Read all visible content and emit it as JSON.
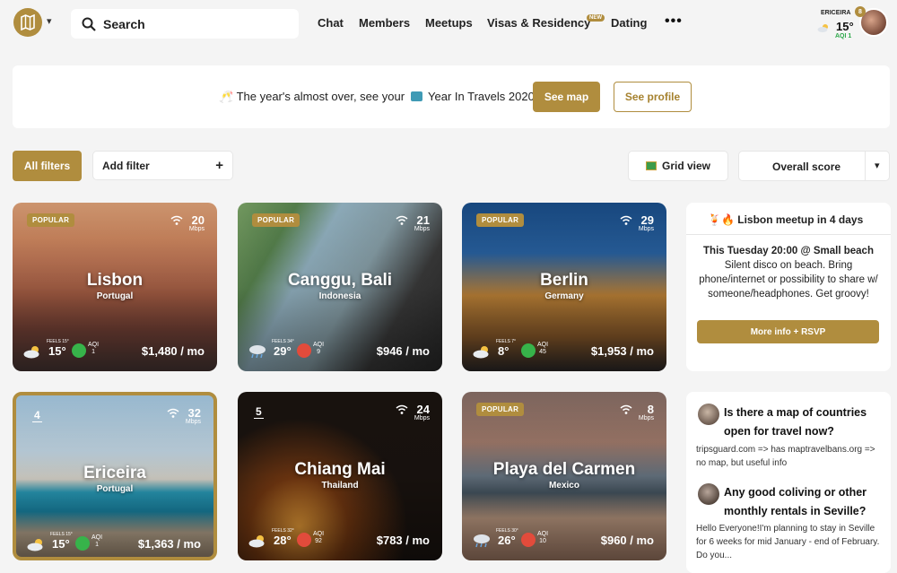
{
  "header": {
    "search_label": "Search",
    "nav": [
      {
        "label": "Chat"
      },
      {
        "label": "Members"
      },
      {
        "label": "Meetups"
      },
      {
        "label": "Visas & Residency"
      },
      {
        "label": "Dating"
      }
    ],
    "new_badge": "NEW",
    "more": "•••",
    "location": {
      "name": "ERICEIRA",
      "temp": "15°",
      "aqi": "AQI 1",
      "notifications": "8"
    }
  },
  "banner": {
    "text_part1": "The year's almost over, see your",
    "text_part2": "Year In Travels 2020",
    "see_map": "See map",
    "see_profile": "See profile"
  },
  "filters": {
    "all_filters": "All filters",
    "add_filter": "Add filter",
    "add_icon": "+",
    "grid_view": "Grid view",
    "sort": "Overall score"
  },
  "cities": [
    {
      "rank": "",
      "popular": "POPULAR",
      "mbps": "20",
      "mbps_unit": "Mbps",
      "name": "Lisbon",
      "country": "Portugal",
      "feels": "FEELS 15°",
      "temp": "15°",
      "aqi_label": "AQI",
      "aqi": "1",
      "price": "$1,480 / mo",
      "weather": "cloud-sun",
      "aqi_face": "happy"
    },
    {
      "rank": "",
      "popular": "POPULAR",
      "mbps": "21",
      "mbps_unit": "Mbps",
      "name": "Canggu, Bali",
      "country": "Indonesia",
      "feels": "FEELS 34°",
      "temp": "29°",
      "aqi_label": "AQI",
      "aqi": "9",
      "price": "$946 / mo",
      "weather": "rain",
      "aqi_face": "angry"
    },
    {
      "rank": "",
      "popular": "POPULAR",
      "mbps": "29",
      "mbps_unit": "Mbps",
      "name": "Berlin",
      "country": "Germany",
      "feels": "FEELS 7°",
      "temp": "8°",
      "aqi_label": "AQI",
      "aqi": "45",
      "price": "$1,953 / mo",
      "weather": "cloud-sun",
      "aqi_face": "happy"
    },
    {
      "rank": "4",
      "popular": "",
      "mbps": "32",
      "mbps_unit": "Mbps",
      "name": "Ericeira",
      "country": "Portugal",
      "feels": "FEELS 15°",
      "temp": "15°",
      "aqi_label": "AQI",
      "aqi": "1",
      "price": "$1,363 / mo",
      "weather": "cloud-sun",
      "aqi_face": "happy"
    },
    {
      "rank": "5",
      "popular": "",
      "mbps": "24",
      "mbps_unit": "Mbps",
      "name": "Chiang Mai",
      "country": "Thailand",
      "feels": "FEELS 32°",
      "temp": "28°",
      "aqi_label": "AQI",
      "aqi": "92",
      "price": "$783 / mo",
      "weather": "cloud-sun",
      "aqi_face": "angry"
    },
    {
      "rank": "",
      "popular": "POPULAR",
      "mbps": "8",
      "mbps_unit": "Mbps",
      "name": "Playa del Carmen",
      "country": "Mexico",
      "feels": "FEELS 30°",
      "temp": "26°",
      "aqi_label": "AQI",
      "aqi": "10",
      "price": "$960 / mo",
      "weather": "rain",
      "aqi_face": "angry"
    }
  ],
  "meetup": {
    "title": "Lisbon meetup in 4 days",
    "headline": "This Tuesday 20:00 @ Small beach",
    "body": "Silent disco on beach. Bring phone/internet or possibility to share w/ someone/headphones. Get groovy!",
    "button": "More info + RSVP"
  },
  "questions": [
    {
      "title": "Is there a map of countries open for travel now?",
      "body": "tripsguard.com => has maptravelbans.org => no map, but useful info"
    },
    {
      "title": "Any good coliving or other monthly rentals in Seville?",
      "body": "Hello Everyone!I'm planning to stay in Seville for 6 weeks for mid January - end of February. Do you..."
    }
  ],
  "colors": {
    "accent": "#b08d3e",
    "aqi_good": "#2da84a"
  }
}
